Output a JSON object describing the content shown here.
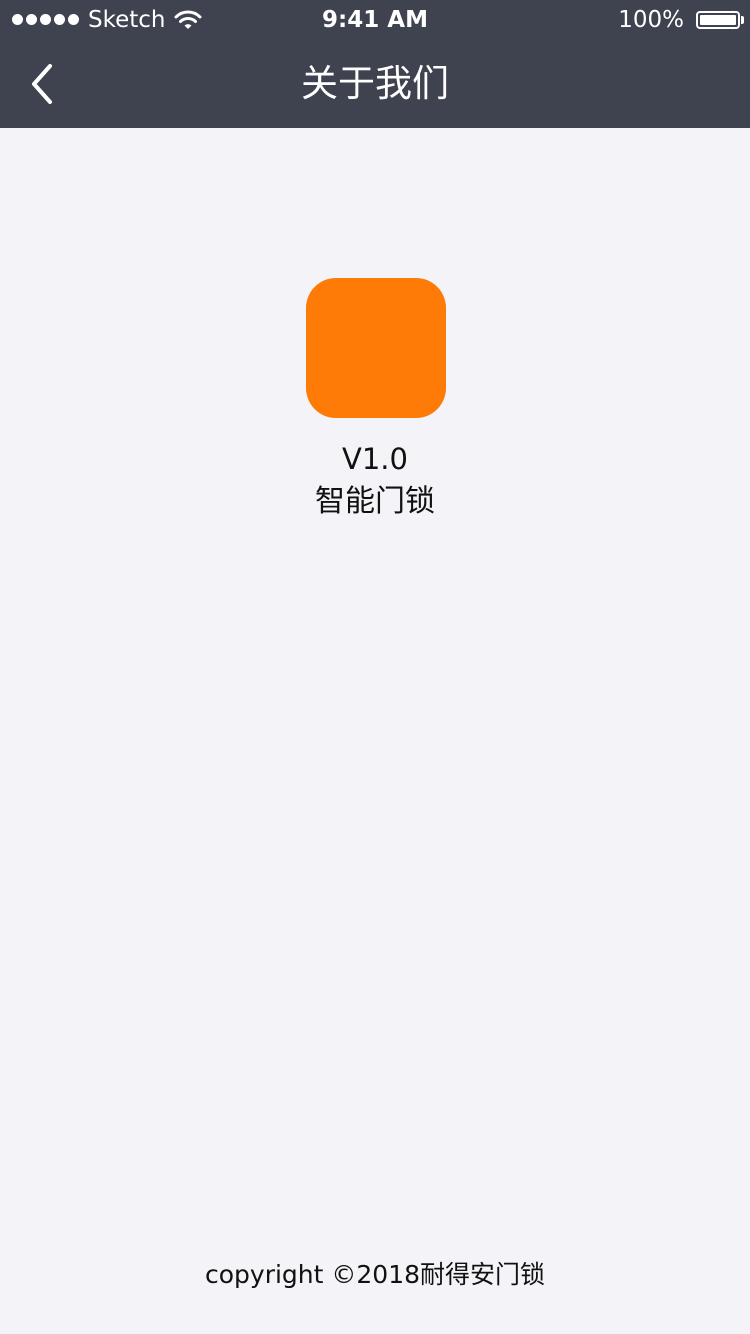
{
  "status_bar": {
    "carrier": "Sketch",
    "time": "9:41 AM",
    "battery_percent": "100%",
    "signal_bars": 5,
    "signal_icon": "signal-dots-icon",
    "wifi_icon": "wifi-icon",
    "battery_icon": "battery-full-icon"
  },
  "nav": {
    "title": "关于我们",
    "back_icon": "chevron-left-icon",
    "background_color": "#3f424f"
  },
  "about": {
    "app_icon_color": "#ff7b08",
    "version": "V1.0",
    "app_name": "智能门锁"
  },
  "footer": {
    "copyright": "copyright ©2018耐得安门锁"
  },
  "colors": {
    "page_background": "#f4f3f8",
    "header_background": "#3f424f",
    "accent": "#ff7b08"
  }
}
